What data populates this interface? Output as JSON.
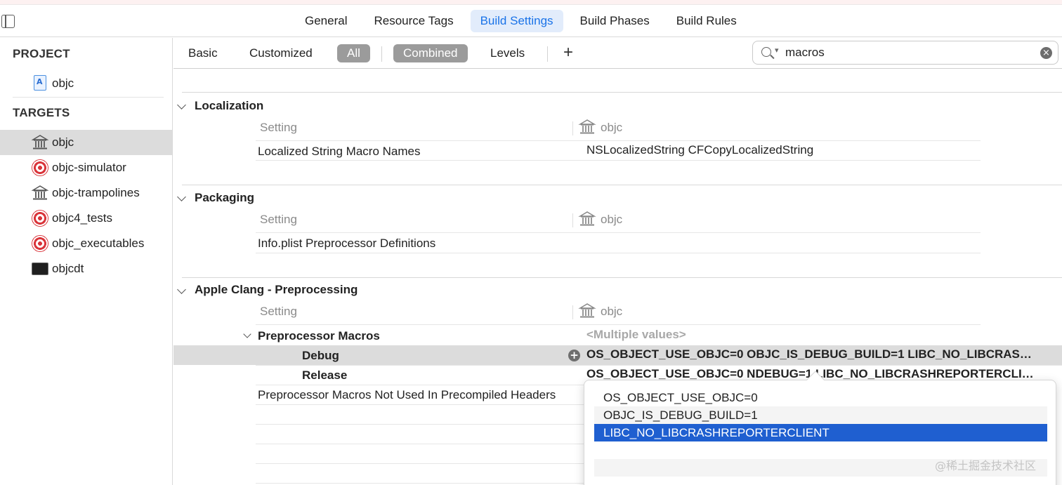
{
  "tabs": {
    "general": "General",
    "resource_tags": "Resource Tags",
    "build_settings": "Build Settings",
    "build_phases": "Build Phases",
    "build_rules": "Build Rules",
    "active": "Build Settings"
  },
  "sidebar": {
    "project_header": "PROJECT",
    "project_items": [
      {
        "label": "objc",
        "icon": "project-file-icon"
      }
    ],
    "targets_header": "TARGETS",
    "target_items": [
      {
        "label": "objc",
        "icon": "framework-icon",
        "selected": true
      },
      {
        "label": "objc-simulator",
        "icon": "target-icon"
      },
      {
        "label": "objc-trampolines",
        "icon": "framework-icon"
      },
      {
        "label": "objc4_tests",
        "icon": "target-icon"
      },
      {
        "label": "objc_executables",
        "icon": "target-icon"
      },
      {
        "label": "objcdt",
        "icon": "terminal-icon"
      }
    ]
  },
  "filterbar": {
    "basic": "Basic",
    "customized": "Customized",
    "all": "All",
    "combined": "Combined",
    "levels": "Levels",
    "add": "+",
    "search_value": "macros"
  },
  "groups": {
    "localization": {
      "title": "Localization",
      "setting_header": "Setting",
      "target_header": "objc",
      "rows": [
        {
          "label": "Localized String Macro Names",
          "value": "NSLocalizedString CFCopyLocalizedString"
        }
      ]
    },
    "packaging": {
      "title": "Packaging",
      "setting_header": "Setting",
      "target_header": "objc",
      "rows": [
        {
          "label": "Info.plist Preprocessor Definitions",
          "value": ""
        }
      ]
    },
    "clang": {
      "title": "Apple Clang - Preprocessing",
      "setting_header": "Setting",
      "target_header": "objc",
      "macros_label": "Preprocessor Macros",
      "macros_value": "<Multiple values>",
      "debug_label": "Debug",
      "debug_value": "OS_OBJECT_USE_OBJC=0 OBJC_IS_DEBUG_BUILD=1 LIBC_NO_LIBCRAS…",
      "release_label": "Release",
      "release_value": "OS_OBJECT_USE_OBJC=0 NDEBUG=1 LIBC_NO_LIBCRASHREPORTERCLI…",
      "not_used_label": "Preprocessor Macros Not Used In Precompiled Headers"
    }
  },
  "popover": {
    "items": [
      "OS_OBJECT_USE_OBJC=0",
      "OBJC_IS_DEBUG_BUILD=1",
      "LIBC_NO_LIBCRASHREPORTERCLIENT"
    ],
    "selected_index": 2
  },
  "watermark": "@稀土掘金技术社区",
  "colors": {
    "accent": "#1a73e8",
    "selection": "#1f5fd0",
    "pill": "#9b9b9b"
  }
}
